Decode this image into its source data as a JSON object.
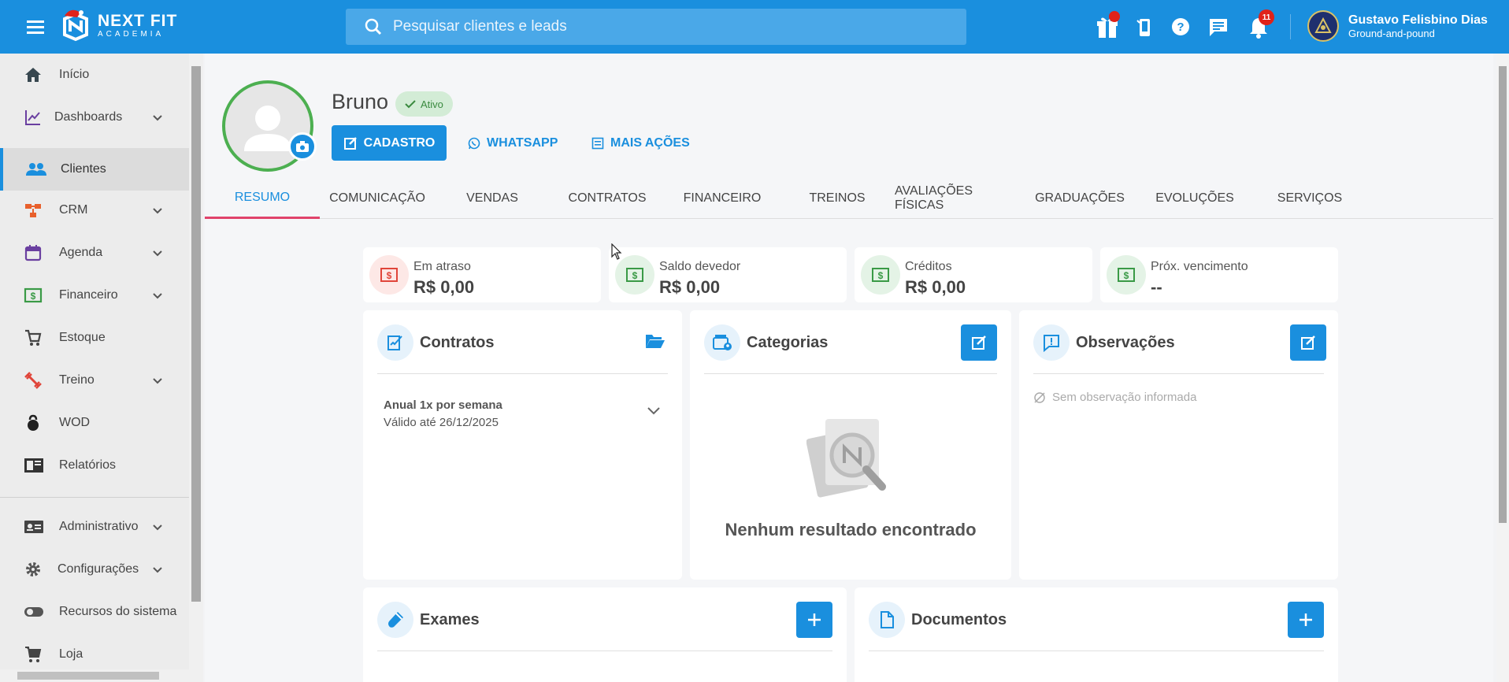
{
  "app": {
    "logo_name": "NEXT FIT",
    "logo_sub": "ACADEMIA"
  },
  "search": {
    "placeholder": "Pesquisar clientes e leads"
  },
  "topbar": {
    "notifications_count": "11"
  },
  "user": {
    "name": "Gustavo Felisbino Dias",
    "gym": "Ground-and-pound"
  },
  "sidebar": {
    "items": [
      {
        "label": "Início",
        "icon": "home-icon"
      },
      {
        "label": "Dashboards",
        "icon": "chart-icon"
      },
      {
        "label": "Clientes",
        "icon": "people-icon"
      },
      {
        "label": "CRM",
        "icon": "crm-icon"
      },
      {
        "label": "Agenda",
        "icon": "calendar-icon"
      },
      {
        "label": "Financeiro",
        "icon": "money-icon"
      },
      {
        "label": "Estoque",
        "icon": "cart-icon"
      },
      {
        "label": "Treino",
        "icon": "dumbbell-icon"
      },
      {
        "label": "WOD",
        "icon": "kettlebell-icon"
      },
      {
        "label": "Relatórios",
        "icon": "report-icon"
      },
      {
        "label": "Administrativo",
        "icon": "idcard-icon"
      },
      {
        "label": "Configurações",
        "icon": "gear-icon"
      },
      {
        "label": "Recursos do sistema",
        "icon": "toggle-icon"
      },
      {
        "label": "Loja",
        "icon": "shop-cart-icon"
      }
    ]
  },
  "client": {
    "name": "Bruno",
    "status": "Ativo"
  },
  "actions": {
    "cadastro": "CADASTRO",
    "whatsapp": "WHATSAPP",
    "mais": "MAIS AÇÕES"
  },
  "tabs": [
    "RESUMO",
    "COMUNICAÇÃO",
    "VENDAS",
    "CONTRATOS",
    "FINANCEIRO",
    "TREINOS",
    "AVALIAÇÕES FÍSICAS",
    "GRADUAÇÕES",
    "EVOLUÇÕES",
    "SERVIÇOS"
  ],
  "stats": [
    {
      "label": "Em atraso",
      "value": "R$ 0,00",
      "color": "#e0453a"
    },
    {
      "label": "Saldo devedor",
      "value": "R$ 0,00",
      "color": "#3a9a46"
    },
    {
      "label": "Créditos",
      "value": "R$ 0,00",
      "color": "#3a9a46"
    },
    {
      "label": "Próx. vencimento",
      "value": "--",
      "color": "#3a9a46"
    }
  ],
  "contracts": {
    "title": "Contratos",
    "plan": "Anual 1x por semana",
    "valid": "Válido até 26/12/2025"
  },
  "categories": {
    "title": "Categorias",
    "empty": "Nenhum resultado encontrado"
  },
  "observations": {
    "title": "Observações",
    "empty": "Sem observação informada"
  },
  "exams": {
    "title": "Exames"
  },
  "documents": {
    "title": "Documentos"
  },
  "colors": {
    "primary": "#1a8fde",
    "active_green": "#4caf50",
    "tab_underline": "#e0436b"
  }
}
